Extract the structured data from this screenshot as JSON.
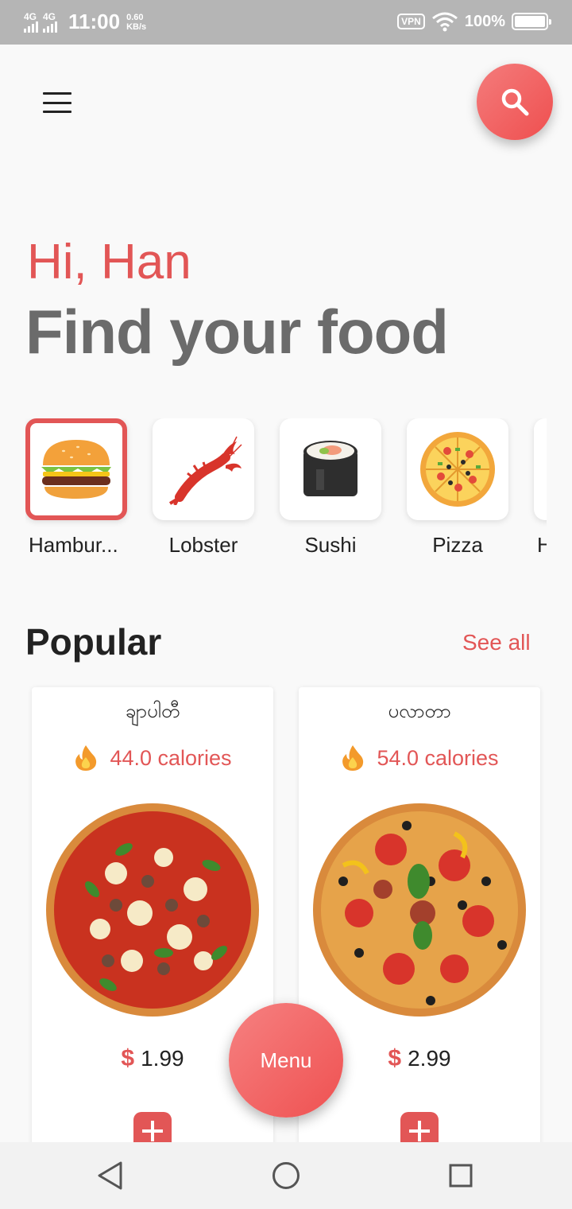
{
  "status_bar": {
    "network_1": "4G",
    "network_2": "4G",
    "time": "11:00",
    "speed_value": "0.60",
    "speed_unit": "KB/s",
    "vpn": "VPN",
    "battery": "100%"
  },
  "header": {
    "menu_icon": "hamburger-icon",
    "search_icon": "search-icon"
  },
  "greeting": "Hi, Han",
  "headline": "Find your food",
  "categories": [
    {
      "label": "Hambur...",
      "icon": "hamburger-food-icon",
      "selected": true
    },
    {
      "label": "Lobster",
      "icon": "lobster-icon",
      "selected": false
    },
    {
      "label": "Sushi",
      "icon": "sushi-icon",
      "selected": false
    },
    {
      "label": "Pizza",
      "icon": "pizza-icon",
      "selected": false
    },
    {
      "label": "H",
      "icon": "",
      "selected": false
    }
  ],
  "popular": {
    "title": "Popular",
    "see_all": "See all",
    "items": [
      {
        "name": "ချာပါတီ",
        "calories": "44.0 calories",
        "currency": "$",
        "price": "1.99"
      },
      {
        "name": "ပလာတာ",
        "calories": "54.0 calories",
        "currency": "$",
        "price": "2.99"
      }
    ]
  },
  "menu_button": "Menu",
  "colors": {
    "accent": "#e25656",
    "heading_gray": "#6b6b6b",
    "status_bar": "#b5b5b5"
  }
}
